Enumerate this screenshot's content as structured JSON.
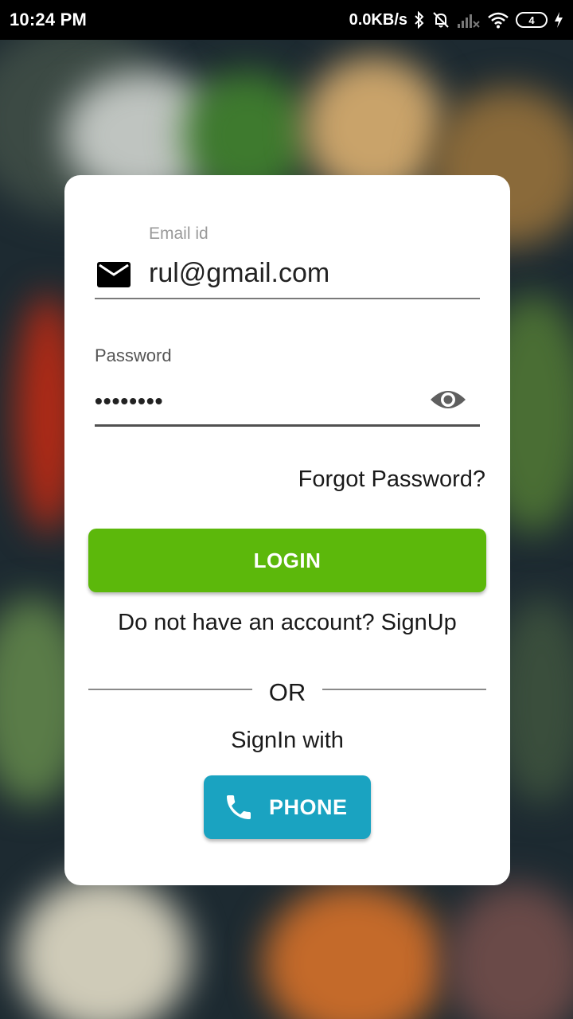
{
  "status_bar": {
    "time": "10:24 PM",
    "network_speed": "0.0KB/s",
    "battery_level": "4",
    "icons": [
      "bluetooth-icon",
      "mute-bell-icon",
      "signal-icon",
      "wifi-icon",
      "battery-icon",
      "charging-icon"
    ]
  },
  "background": {
    "description_icon": "food-photo-background"
  },
  "login_form": {
    "email_label": "Email id",
    "email_value": "rul@gmail.com",
    "password_label": "Password",
    "password_value": "••••••••",
    "forgot_password": "Forgot Password?",
    "login_button": "LOGIN",
    "signup_prompt": "Do not have an account? SignUp",
    "or_text": "OR",
    "signin_with": "SignIn with",
    "phone_button": "PHONE"
  },
  "colors": {
    "login_button": "#5cb80b",
    "phone_button": "#1aa3c1",
    "card": "#ffffff",
    "status_bar": "#000000"
  }
}
